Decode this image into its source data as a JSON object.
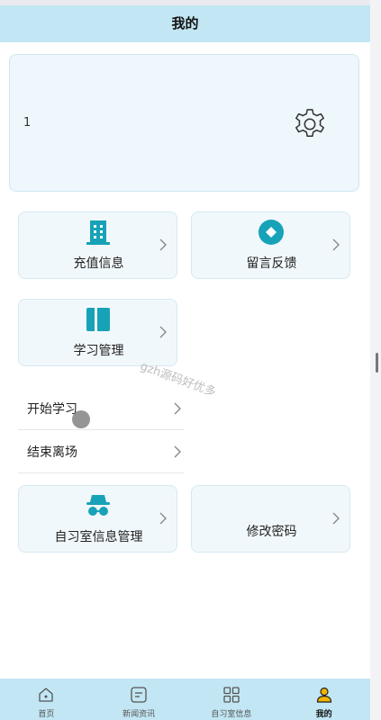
{
  "header": {
    "title": "我的"
  },
  "profile": {
    "name": "1",
    "settings_icon": "gear-icon"
  },
  "tiles": {
    "recharge": {
      "label": "充值信息",
      "icon": "building-icon"
    },
    "feedback": {
      "label": "留言反馈",
      "icon": "diamond-icon"
    },
    "study": {
      "label": "学习管理",
      "icon": "book-icon"
    },
    "studyroom": {
      "label": "自习室信息管理",
      "icon": "incognito-icon"
    },
    "password": {
      "label": "修改密码"
    }
  },
  "submenu": [
    {
      "label": "开始学习"
    },
    {
      "label": "结束离场"
    }
  ],
  "watermark": "gzh源码好优多",
  "bottom_nav": [
    {
      "label": "首页",
      "icon": "home-icon"
    },
    {
      "label": "新闻资讯",
      "icon": "news-icon"
    },
    {
      "label": "自习室信息",
      "icon": "grid-icon"
    },
    {
      "label": "我的",
      "icon": "user-icon",
      "active": true
    }
  ],
  "colors": {
    "accent": "#17a2b8",
    "bar": "#c2e6f3",
    "card": "#eef7fc"
  }
}
